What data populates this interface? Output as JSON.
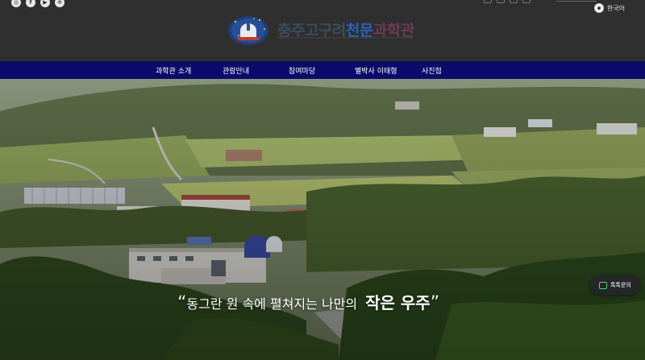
{
  "header": {
    "social": [
      {
        "name": "instagram",
        "glyph": "◎"
      },
      {
        "name": "facebook",
        "glyph": "f"
      },
      {
        "name": "youtube",
        "glyph": "▶"
      },
      {
        "name": "blog",
        "glyph": "✲"
      }
    ],
    "language": "한국어",
    "logo": {
      "part1": "충주고구려",
      "part2": "천문",
      "part3": "과학관"
    }
  },
  "nav": {
    "items": [
      {
        "label": "과학관 소개"
      },
      {
        "label": "관람안내"
      },
      {
        "label": "참여마당"
      },
      {
        "label": "별박사 이태형"
      },
      {
        "label": "사진첩"
      }
    ]
  },
  "hero": {
    "tagline": "동그란 원 속에 펼쳐지는 나만의",
    "tagline_emphasis": "작은 우주",
    "quote_open": "“",
    "quote_close": "”"
  },
  "chat": {
    "label": "톡톡문의"
  },
  "colors": {
    "nav_bg": "#0b0b6b",
    "header_bg": "#2f2f30",
    "logo_blue": "#2a62b8"
  }
}
